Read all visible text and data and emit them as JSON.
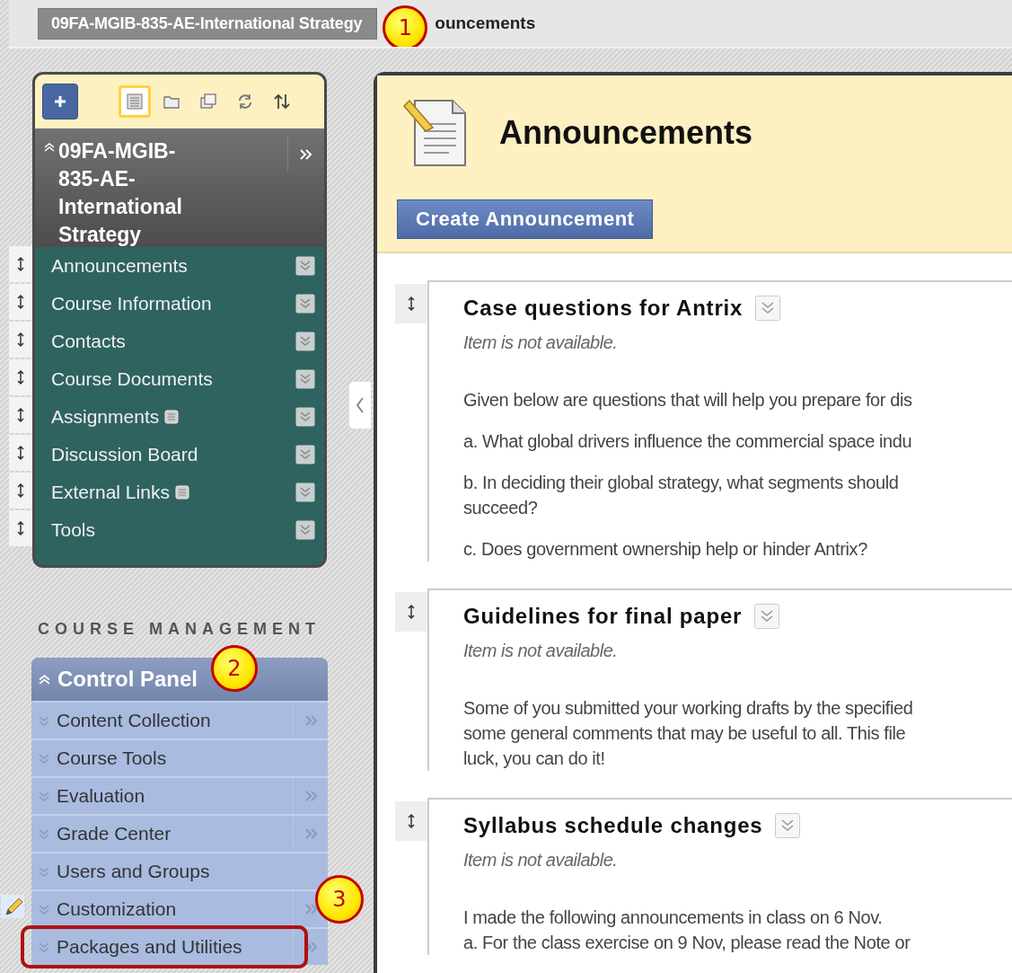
{
  "breadcrumbs": {
    "callout": "1",
    "items": [
      {
        "label": "09FA-MGIB-835-AE-International Strategy",
        "kind": "course"
      },
      {
        "label": "ouncements",
        "kind": "page"
      }
    ]
  },
  "course_menu": {
    "tools": [
      {
        "kind": "list",
        "selected": true
      },
      {
        "kind": "folder",
        "selected": false
      },
      {
        "kind": "windows",
        "selected": false
      },
      {
        "kind": "refresh",
        "selected": false
      },
      {
        "kind": "sort",
        "selected": false
      }
    ],
    "title": "09FA-MGIB-835-AE-International Strategy",
    "items": [
      {
        "label": "Announcements",
        "has_page_icon": false
      },
      {
        "label": "Course Information",
        "has_page_icon": false
      },
      {
        "label": "Contacts",
        "has_page_icon": false
      },
      {
        "label": "Course Documents",
        "has_page_icon": false
      },
      {
        "label": "Assignments",
        "has_page_icon": true
      },
      {
        "label": "Discussion Board",
        "has_page_icon": false
      },
      {
        "label": "External Links",
        "has_page_icon": true
      },
      {
        "label": "Tools",
        "has_page_icon": false
      }
    ]
  },
  "course_management": {
    "heading": "COURSE MANAGEMENT"
  },
  "control_panel": {
    "title": "Control Panel",
    "callout": "2",
    "items": [
      {
        "label": "Content Collection",
        "has_submenu": true,
        "has_edit_icon": false,
        "highlighted": false
      },
      {
        "label": "Course Tools",
        "has_submenu": false,
        "has_edit_icon": false,
        "highlighted": false
      },
      {
        "label": "Evaluation",
        "has_submenu": true,
        "has_edit_icon": false,
        "highlighted": false
      },
      {
        "label": "Grade Center",
        "has_submenu": true,
        "has_edit_icon": false,
        "highlighted": false
      },
      {
        "label": "Users and Groups",
        "has_submenu": false,
        "has_edit_icon": false,
        "highlighted": false
      },
      {
        "label": "Customization",
        "has_submenu": true,
        "has_edit_icon": true,
        "highlighted": false
      },
      {
        "label": "Packages and Utilities",
        "has_submenu": true,
        "has_edit_icon": false,
        "highlighted": true,
        "callout": "3"
      }
    ]
  },
  "main": {
    "title": "Announcements",
    "create_button": "Create Announcement",
    "items": [
      {
        "title": "Case questions for Antrix",
        "status": "Item is not available.",
        "paragraphs": [
          [
            "Given below are questions that will help you prepare for dis"
          ],
          [
            "a. What global drivers influence the commercial space indu"
          ],
          [
            "b. In deciding their global strategy, what segments should",
            "succeed?"
          ],
          [
            "c. Does government ownership help or hinder Antrix?"
          ]
        ]
      },
      {
        "title": "Guidelines for final paper",
        "status": "Item is not available.",
        "paragraphs": [
          [
            "Some of you submitted your working drafts by the specified",
            "some general comments that may be useful to all. This file",
            "luck, you can do it!"
          ]
        ]
      },
      {
        "title": "Syllabus schedule changes",
        "status": "Item is not available.",
        "paragraphs": [
          [
            "I made the following announcements in class on 6 Nov.",
            "a. For the class exercise on 9 Nov, please read the Note or"
          ]
        ]
      }
    ]
  }
}
